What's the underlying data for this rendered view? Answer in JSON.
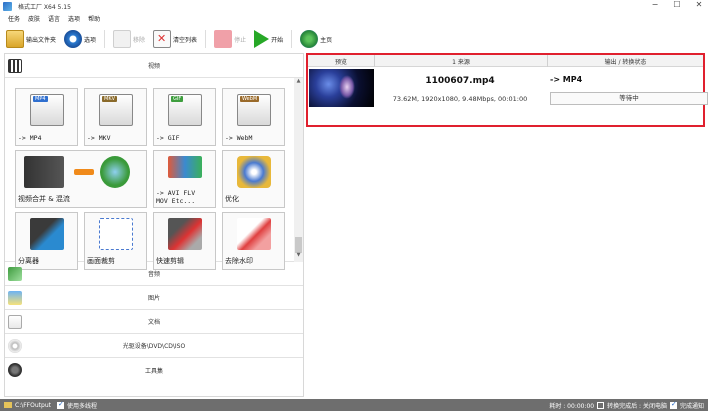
{
  "window": {
    "title": "格式工厂 X64 5.15",
    "controls": [
      "−",
      "☐",
      "✕"
    ]
  },
  "menu": [
    "任务",
    "皮肤",
    "语言",
    "选项",
    "帮助"
  ],
  "toolbar": {
    "output_folder": "输出文件夹",
    "options": "选项",
    "remove": "移除",
    "clear_list": "清空列表",
    "stop": "停止",
    "start": "开始",
    "home": "主页"
  },
  "categories": {
    "video": "视频",
    "audio": "音频",
    "image": "图片",
    "document": "文档",
    "dvd": "光驱设备\\DVD\\CD\\ISO",
    "tools": "工具集"
  },
  "video_tiles": [
    {
      "label": "-> MP4",
      "badge": "MP4",
      "color": "#2f6fcf"
    },
    {
      "label": "-> MKV",
      "badge": "MKV",
      "color": "#8a6a2a"
    },
    {
      "label": "-> GIF",
      "badge": "GIF",
      "color": "#3e9e3e"
    },
    {
      "label": "-> WebM",
      "badge": "WebM",
      "color": "#9a6a2a"
    },
    {
      "label": "视频合并 & 混流"
    },
    {
      "label": "-> AVI FLV\nMOV Etc..."
    },
    {
      "label": "优化"
    },
    {
      "label": "分离器"
    },
    {
      "label": "画面裁剪"
    },
    {
      "label": "快速剪辑"
    },
    {
      "label": "去除水印"
    }
  ],
  "task_table": {
    "headers": [
      "预览",
      "1 来源",
      "输出 / 转换状态"
    ],
    "rows": [
      {
        "filename": "1100607.mp4",
        "info": "73.62M, 1920x1080, 9.48Mbps, 00:01:00",
        "output": "-> MP4",
        "status": "等待中"
      }
    ]
  },
  "statusbar": {
    "output_path": "C:\\FFOutput",
    "multithread": "使用多线程",
    "elapsed_label": "耗时 : 00:00:00",
    "after_convert": "转换完成后 : 关闭电脑",
    "notify": "完成通知"
  }
}
